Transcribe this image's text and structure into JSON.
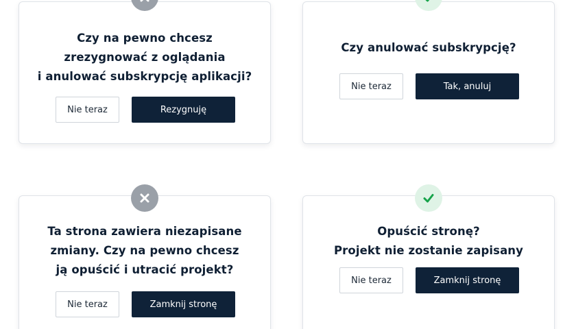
{
  "dialogs": [
    {
      "icon": "close-icon",
      "message": "Czy na pewno chcesz\nzrezygnować z oglądania\ni anulować subskrypcję aplikacji?",
      "secondary_label": "Nie teraz",
      "primary_label": "Rezygnuję"
    },
    {
      "icon": "check-icon",
      "message": "Czy anulować subskrypcję?",
      "secondary_label": "Nie teraz",
      "primary_label": "Tak, anuluj"
    },
    {
      "icon": "close-icon",
      "message": "Ta strona zawiera niezapisane\nzmiany. Czy na pewno chcesz\nją opuścić i utracić projekt?",
      "secondary_label": "Nie teraz",
      "primary_label": "Zamknij stronę"
    },
    {
      "icon": "check-icon",
      "message": "Opuścić stronę?\nProjekt nie zostanie zapisany",
      "secondary_label": "Nie teraz",
      "primary_label": "Zamknij stronę"
    }
  ],
  "colors": {
    "primary_button": "#0f2238",
    "danger_badge": "#9aa0a8",
    "success_badge_bg": "#dff3e6",
    "success_check": "#16a34a",
    "text": "#0f1f33"
  }
}
